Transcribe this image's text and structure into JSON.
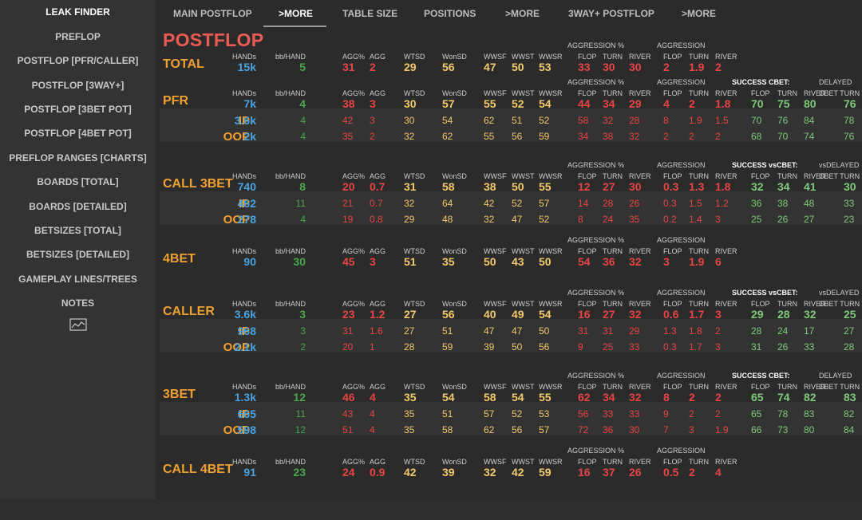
{
  "sidebar": {
    "title": "LEAK FINDER",
    "items": [
      "PREFLOP",
      "POSTFLOP [PFR/CALLER]",
      "POSTFLOP [3WAY+]",
      "POSTFLOP [3BET POT]",
      "POSTFLOP [4BET POT]",
      "PREFLOP RANGES [CHARTS]",
      "BOARDS [TOTAL]",
      "BOARDS [DETAILED]",
      "BETSIZES [TOTAL]",
      "BETSIZES [DETAILED]",
      "GAMEPLAY LINES/TREES",
      "NOTES"
    ],
    "chart_icon": "line-chart-icon"
  },
  "tabs": [
    "MAIN POSTFLOP",
    ">MORE",
    "TABLE SIZE",
    "POSITIONS",
    ">MORE",
    "3WAY+ POSTFLOP",
    ">MORE"
  ],
  "active_tab": 1,
  "page_title": "POSTFLOP",
  "headers": {
    "hands": "HANDs",
    "bbhand": "bb/HAND",
    "aggpct": "AGG%",
    "agg": "AGG",
    "wtsd": "WTSD",
    "wonsd": "WonSD",
    "wwsf": "WWSF",
    "wwst": "WWST",
    "wwsr": "WWSR",
    "flop": "FLOP",
    "turn": "TURN",
    "river": "RIVER",
    "aggression_pct": "AGGRESSION %",
    "aggression": "AGGRESSION",
    "success_cbet": "SUCCESS CBET:",
    "success_vscbet": "SUCCESS vsCBET:",
    "delayed": "DELAYED",
    "vsdelayed": "vsDELAYED",
    "cbet_turn": "CBET TURN"
  },
  "colors": {
    "blue": "#4aa3e0",
    "green": "#49a84a",
    "red": "#e84444",
    "yellow": "#f2c96b",
    "light_green": "#7fc97a",
    "orange": "#f0a030",
    "title_red": "#ec5a52"
  },
  "sections": [
    {
      "title": "TOTAL",
      "extra": "none",
      "delayed_label": "",
      "rows": [
        {
          "label": "",
          "v": [
            "15k",
            "5",
            "31",
            "2",
            "29",
            "56",
            "47",
            "50",
            "53",
            "33",
            "30",
            "30",
            "2",
            "1.9",
            "2"
          ]
        }
      ]
    },
    {
      "title": "PFR",
      "extra": "cbet",
      "delayed_label": "DELAYED",
      "rows": [
        {
          "label": "",
          "v": [
            "7k",
            "4",
            "38",
            "3",
            "30",
            "57",
            "55",
            "52",
            "54",
            "44",
            "34",
            "29",
            "4",
            "2",
            "1.8",
            "70",
            "75",
            "80",
            "76"
          ]
        },
        {
          "label": "IP",
          "v": [
            "3.6k",
            "4",
            "42",
            "3",
            "30",
            "54",
            "62",
            "51",
            "52",
            "58",
            "32",
            "28",
            "8",
            "1.9",
            "1.5",
            "70",
            "76",
            "84",
            "78"
          ]
        },
        {
          "label": "OOP",
          "v": [
            "2k",
            "4",
            "35",
            "2",
            "32",
            "62",
            "55",
            "56",
            "59",
            "34",
            "38",
            "32",
            "2",
            "2",
            "2",
            "68",
            "70",
            "74",
            "76"
          ]
        }
      ]
    },
    {
      "title": "CALL 3BET",
      "extra": "vscbet",
      "delayed_label": "vsDELAYED",
      "rows": [
        {
          "label": "",
          "v": [
            "740",
            "8",
            "20",
            "0.7",
            "31",
            "58",
            "38",
            "50",
            "55",
            "12",
            "27",
            "30",
            "0.3",
            "1.3",
            "1.8",
            "32",
            "34",
            "41",
            "30"
          ]
        },
        {
          "label": "IP",
          "v": [
            "462",
            "11",
            "21",
            "0.7",
            "32",
            "64",
            "42",
            "52",
            "57",
            "14",
            "28",
            "26",
            "0.3",
            "1.5",
            "1.2",
            "36",
            "38",
            "48",
            "33"
          ]
        },
        {
          "label": "OOP",
          "v": [
            "278",
            "4",
            "19",
            "0.8",
            "29",
            "48",
            "32",
            "47",
            "52",
            "8",
            "24",
            "35",
            "0.2",
            "1.4",
            "3",
            "25",
            "26",
            "27",
            "23"
          ]
        }
      ]
    },
    {
      "title": "4BET",
      "extra": "none",
      "delayed_label": "",
      "rows": [
        {
          "label": "",
          "v": [
            "90",
            "30",
            "45",
            "3",
            "51",
            "35",
            "50",
            "43",
            "50",
            "54",
            "36",
            "32",
            "3",
            "1.9",
            "6"
          ]
        }
      ]
    },
    {
      "title": "CALLER",
      "extra": "vscbet",
      "delayed_label": "vsDELAYED",
      "rows": [
        {
          "label": "",
          "v": [
            "3.6k",
            "3",
            "23",
            "1.2",
            "27",
            "56",
            "40",
            "49",
            "54",
            "16",
            "27",
            "32",
            "0.6",
            "1.7",
            "3",
            "29",
            "28",
            "32",
            "25"
          ]
        },
        {
          "label": "IP",
          "v": [
            "968",
            "3",
            "31",
            "1.6",
            "27",
            "51",
            "47",
            "47",
            "50",
            "31",
            "31",
            "29",
            "1.3",
            "1.8",
            "2",
            "28",
            "24",
            "17",
            "27"
          ]
        },
        {
          "label": "OOP",
          "v": [
            "2.1k",
            "2",
            "20",
            "1",
            "28",
            "59",
            "39",
            "50",
            "56",
            "9",
            "25",
            "33",
            "0.3",
            "1.7",
            "3",
            "31",
            "26",
            "33",
            "28"
          ]
        }
      ]
    },
    {
      "title": "3BET",
      "extra": "cbet",
      "delayed_label": "DELAYED",
      "rows": [
        {
          "label": "",
          "v": [
            "1.3k",
            "12",
            "46",
            "4",
            "35",
            "54",
            "58",
            "54",
            "55",
            "62",
            "34",
            "32",
            "8",
            "2",
            "2",
            "65",
            "74",
            "82",
            "83"
          ]
        },
        {
          "label": "IP",
          "v": [
            "665",
            "11",
            "43",
            "4",
            "35",
            "51",
            "57",
            "52",
            "53",
            "56",
            "33",
            "33",
            "9",
            "2",
            "2",
            "65",
            "78",
            "83",
            "82"
          ]
        },
        {
          "label": "OOP",
          "v": [
            "598",
            "12",
            "51",
            "4",
            "35",
            "58",
            "62",
            "56",
            "57",
            "72",
            "36",
            "30",
            "7",
            "3",
            "1.9",
            "66",
            "73",
            "80",
            "84"
          ]
        }
      ]
    },
    {
      "title": "CALL 4BET",
      "extra": "none",
      "delayed_label": "",
      "rows": [
        {
          "label": "",
          "v": [
            "91",
            "23",
            "24",
            "0.9",
            "42",
            "39",
            "32",
            "42",
            "59",
            "16",
            "37",
            "26",
            "0.5",
            "2",
            "4"
          ]
        }
      ]
    }
  ]
}
